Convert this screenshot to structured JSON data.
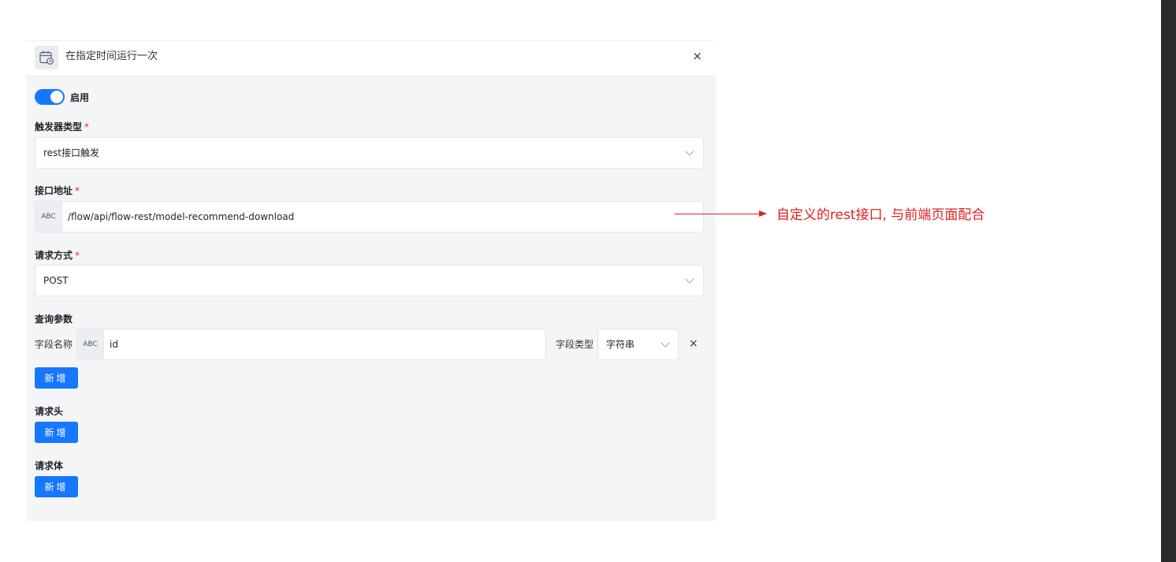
{
  "header": {
    "title": "在指定时间运行一次",
    "close_glyph": "×"
  },
  "enable": {
    "label": "启用",
    "on": true
  },
  "trigger_type": {
    "label": "触发器类型",
    "required_mark": "*",
    "value": "rest接口触发"
  },
  "endpoint": {
    "label": "接口地址",
    "required_mark": "*",
    "addon": "ABC",
    "value": "/flow/api/flow-rest/model-recommend-download"
  },
  "method": {
    "label": "请求方式",
    "required_mark": "*",
    "value": "POST"
  },
  "query_params": {
    "label": "查询参数",
    "rows": [
      {
        "field_name_label": "字段名称",
        "addon": "ABC",
        "field_name_value": "id",
        "field_type_label": "字段类型",
        "field_type_value": "字符串",
        "remove_glyph": "×"
      }
    ],
    "add_button": "新增"
  },
  "headers": {
    "label": "请求头",
    "add_button": "新增"
  },
  "body": {
    "label": "请求体",
    "add_button": "新增"
  },
  "annotation": {
    "text": "自定义的rest接口, 与前端页面配合",
    "color": "#e02020"
  },
  "colors": {
    "primary": "#1677ff",
    "panel_bg": "#f3f5f7",
    "required": "#f5222d"
  }
}
